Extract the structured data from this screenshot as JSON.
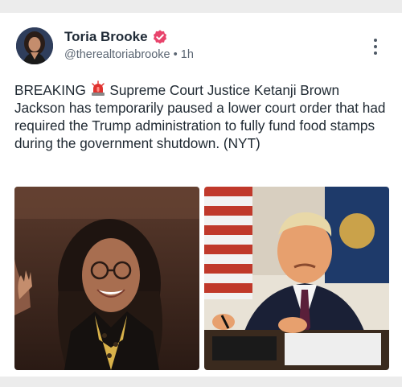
{
  "post": {
    "author_name": "Toria Brooke",
    "handle": "@therealtoriabrooke",
    "separator": "•",
    "time": "1h",
    "text_prefix": "BREAKING",
    "text_body": "Supreme Court Justice Ketanji Brown Jackson has temporarily paused a lower court order that had required the Trump administration to fully fund food stamps during the government shutdown. (NYT)"
  },
  "icons": {
    "avatar": "avatar-photo",
    "verified": "verified-badge-icon",
    "siren": "siren-emoji-icon",
    "menu": "more-vertical-icon"
  },
  "colors": {
    "verified_badge": "#e8436b",
    "text": "#202a33",
    "muted": "#5b6673"
  },
  "media": [
    {
      "name": "photo-ketanji-brown-jackson"
    },
    {
      "name": "photo-donald-trump"
    }
  ]
}
